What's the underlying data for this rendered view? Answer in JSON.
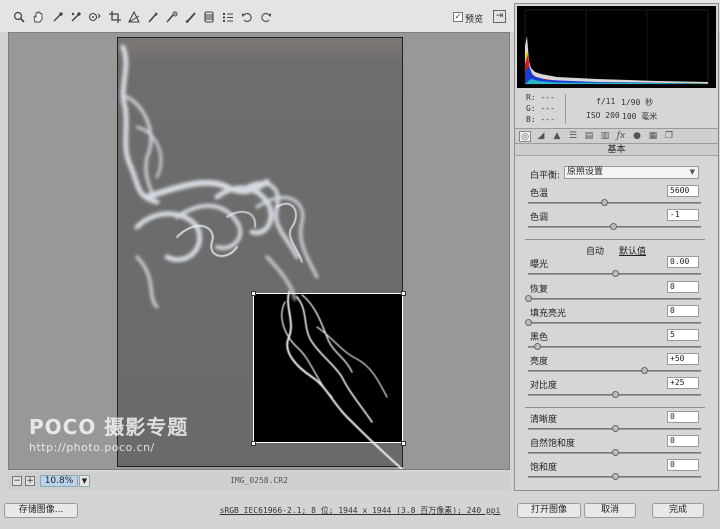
{
  "toolbar": {
    "tools": [
      "zoom-tool-icon",
      "hand-tool-icon",
      "white-balance-tool-icon",
      "color-sampler-icon",
      "target-adjust-icon",
      "crop-tool-icon",
      "straighten-tool-icon",
      "spot-removal-icon",
      "red-eye-icon",
      "adjustment-brush-icon",
      "graduated-filter-icon",
      "preferences-icon",
      "rotate-left-icon",
      "rotate-right-icon"
    ],
    "preview_checked": "✓",
    "preview_label": "预览"
  },
  "canvas": {
    "watermark_logo": "POCO 摄影专题",
    "watermark_url": "http://photo.poco.cn/"
  },
  "statusbar": {
    "zoom_out": "−",
    "zoom_in": "+",
    "zoom": "10.8%",
    "filename": "IMG_0258.CR2"
  },
  "readouts": {
    "r": "R:  ---",
    "g": "G:  ---",
    "b": "B:  ---",
    "aperture": "f/11",
    "shutter": "1/90 秒",
    "iso": "ISO 200",
    "focal": "100 毫米"
  },
  "panel": {
    "title": "基本",
    "wb_label": "白平衡:",
    "wb_value": "原照设置",
    "auto": "自动",
    "default": "默认值",
    "sliders": [
      {
        "label": "色温",
        "value": "5600",
        "position": 0.44
      },
      {
        "label": "色调",
        "value": "-1",
        "position": 0.49
      },
      {
        "label": "曝光",
        "value": "0.00",
        "position": 0.5
      },
      {
        "label": "恢复",
        "value": "0",
        "position": 0.0
      },
      {
        "label": "填充亮光",
        "value": "0",
        "position": 0.0
      },
      {
        "label": "黑色",
        "value": "5",
        "position": 0.05
      },
      {
        "label": "亮度",
        "value": "+50",
        "position": 0.67
      },
      {
        "label": "对比度",
        "value": "+25",
        "position": 0.5
      },
      {
        "label": "清晰度",
        "value": "0",
        "position": 0.5
      },
      {
        "label": "自然饱和度",
        "value": "0",
        "position": 0.5
      },
      {
        "label": "饱和度",
        "value": "0",
        "position": 0.5
      }
    ]
  },
  "bottom": {
    "save": "存储图像...",
    "workflow": "sRGB IEC61966-2.1; 8 位; 1944 x 1944 (3.8 百万像素); 240 ppi",
    "open": "打开图像",
    "cancel": "取消",
    "done": "完成"
  }
}
